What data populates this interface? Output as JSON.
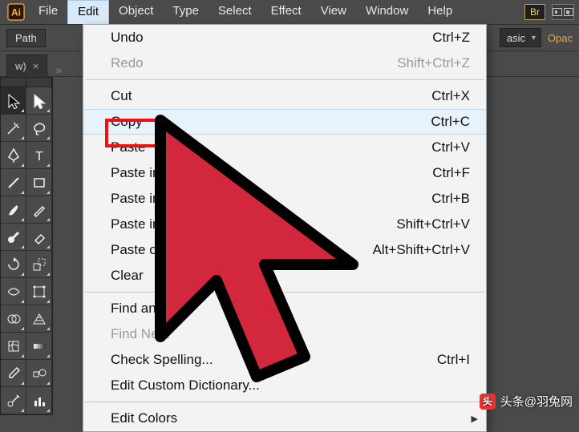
{
  "menubar": {
    "items": [
      "File",
      "Edit",
      "Object",
      "Type",
      "Select",
      "Effect",
      "View",
      "Window",
      "Help"
    ],
    "active_index": 1,
    "br_label": "Br"
  },
  "control_bar": {
    "path_label": "Path",
    "combo_label": "asic",
    "opacity_label": "Opac"
  },
  "tabs": {
    "doc_label": "w)",
    "close_glyph": "×",
    "chevrons": "»"
  },
  "dropdown": {
    "highlight_index": 3,
    "items": [
      {
        "label": "Undo",
        "shortcut": "Ctrl+Z",
        "disabled": false
      },
      {
        "label": "Redo",
        "shortcut": "Shift+Ctrl+Z",
        "disabled": true
      },
      {
        "sep": true
      },
      {
        "label": "Cut",
        "shortcut": "Ctrl+X",
        "disabled": false
      },
      {
        "label": "Copy",
        "shortcut": "Ctrl+C",
        "disabled": false
      },
      {
        "label": "Paste",
        "shortcut": "Ctrl+V",
        "disabled": false
      },
      {
        "label": "Paste in",
        "shortcut": "Ctrl+F",
        "disabled": false
      },
      {
        "label": "Paste in",
        "shortcut": "Ctrl+B",
        "disabled": false
      },
      {
        "label": "Paste in P",
        "shortcut": "Shift+Ctrl+V",
        "disabled": false
      },
      {
        "label": "Paste on A",
        "shortcut": "Alt+Shift+Ctrl+V",
        "disabled": false
      },
      {
        "label": "Clear",
        "shortcut": "",
        "disabled": false
      },
      {
        "sep": true
      },
      {
        "label": "Find and Rep",
        "shortcut": "",
        "disabled": false
      },
      {
        "label": "Find Next",
        "shortcut": "",
        "disabled": true
      },
      {
        "label": "Check Spelling...",
        "shortcut": "Ctrl+I",
        "disabled": false
      },
      {
        "label": "Edit Custom Dictionary...",
        "shortcut": "",
        "disabled": false
      },
      {
        "sep": true
      },
      {
        "label": "Edit Colors",
        "shortcut": "",
        "disabled": false,
        "submenu": true
      }
    ]
  },
  "tools": [
    {
      "name": "selection-tool",
      "selected": true
    },
    {
      "name": "direct-selection-tool"
    },
    {
      "name": "magic-wand-tool"
    },
    {
      "name": "lasso-tool"
    },
    {
      "name": "pen-tool"
    },
    {
      "name": "type-tool"
    },
    {
      "name": "line-segment-tool"
    },
    {
      "name": "rectangle-tool"
    },
    {
      "name": "paintbrush-tool"
    },
    {
      "name": "pencil-tool"
    },
    {
      "name": "blob-brush-tool"
    },
    {
      "name": "eraser-tool"
    },
    {
      "name": "rotate-tool"
    },
    {
      "name": "scale-tool"
    },
    {
      "name": "width-tool"
    },
    {
      "name": "free-transform-tool"
    },
    {
      "name": "shape-builder-tool"
    },
    {
      "name": "perspective-grid-tool"
    },
    {
      "name": "mesh-tool"
    },
    {
      "name": "gradient-tool"
    },
    {
      "name": "eyedropper-tool"
    },
    {
      "name": "blend-tool"
    },
    {
      "name": "symbol-sprayer-tool"
    },
    {
      "name": "column-graph-tool"
    }
  ],
  "watermark": {
    "text": "头条@羽兔网",
    "logo": "头"
  }
}
